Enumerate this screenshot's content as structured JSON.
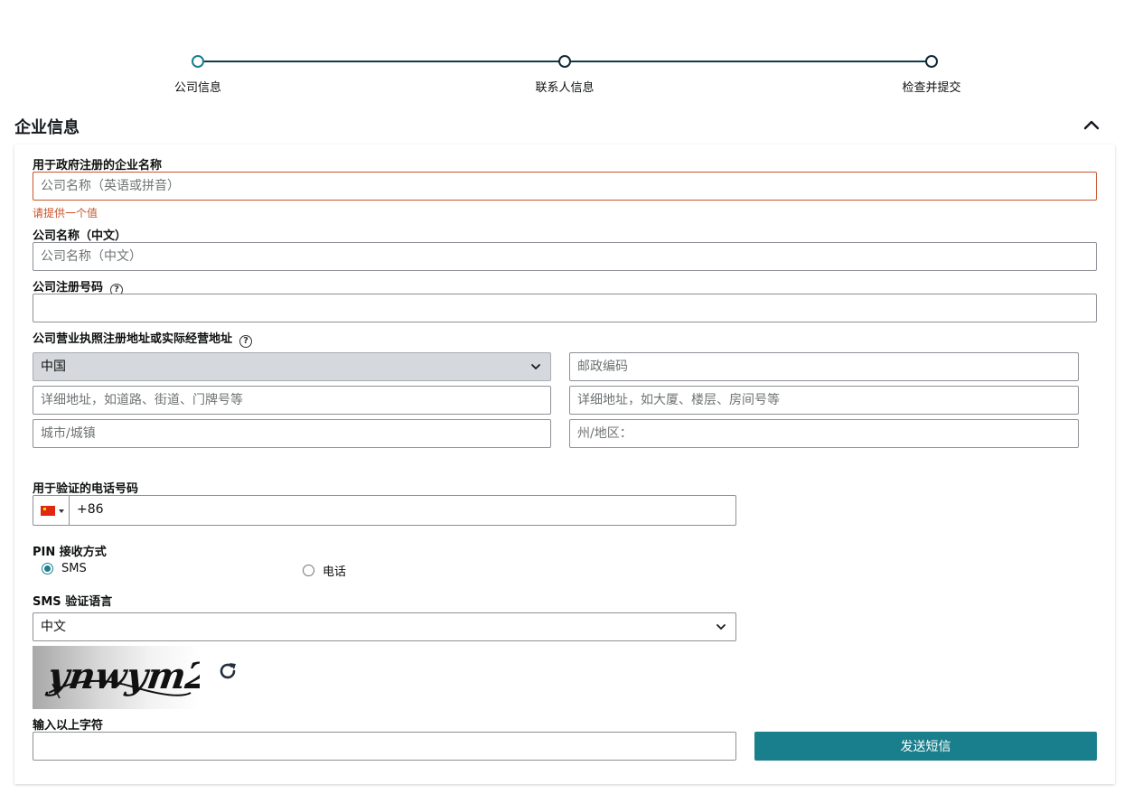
{
  "stepper": {
    "steps": [
      {
        "label": "公司信息"
      },
      {
        "label": "联系人信息"
      },
      {
        "label": "检查并提交"
      }
    ]
  },
  "section": {
    "title": "企业信息"
  },
  "form": {
    "company_name_label": "用于政府注册的企业名称",
    "company_name_placeholder": "公司名称（英语或拼音）",
    "company_name_error": "请提供一个值",
    "company_name_cn_label": "公司名称（中文）",
    "company_name_cn_placeholder": "公司名称（中文）",
    "reg_number_label": "公司注册号码",
    "address_label": "公司营业执照注册地址或实际经营地址",
    "country_value": "中国",
    "postal_placeholder": "邮政编码",
    "address1_placeholder": "详细地址，如道路、街道、门牌号等",
    "address2_placeholder": "详细地址，如大厦、楼层、房间号等",
    "city_placeholder": "城市/城镇",
    "state_placeholder": "州/地区：",
    "phone_label": "用于验证的电话号码",
    "phone_code": "+86",
    "pin_label": "PIN 接收方式",
    "pin_options": [
      {
        "label": "SMS",
        "checked": true
      },
      {
        "label": "电话",
        "checked": false
      }
    ],
    "sms_lang_label": "SMS 验证语言",
    "sms_lang_value": "中文",
    "captcha_text": "ynwym2",
    "captcha_input_label": "输入以上字符",
    "send_button": "发送短信"
  },
  "colors": {
    "accent": "#1a7f8c",
    "error": "#c8542b"
  },
  "icons": {
    "help": "help-circle-icon",
    "collapse": "chevron-up-icon",
    "select": "chevron-down-icon",
    "refresh": "refresh-icon",
    "flag": "china-flag-icon"
  }
}
